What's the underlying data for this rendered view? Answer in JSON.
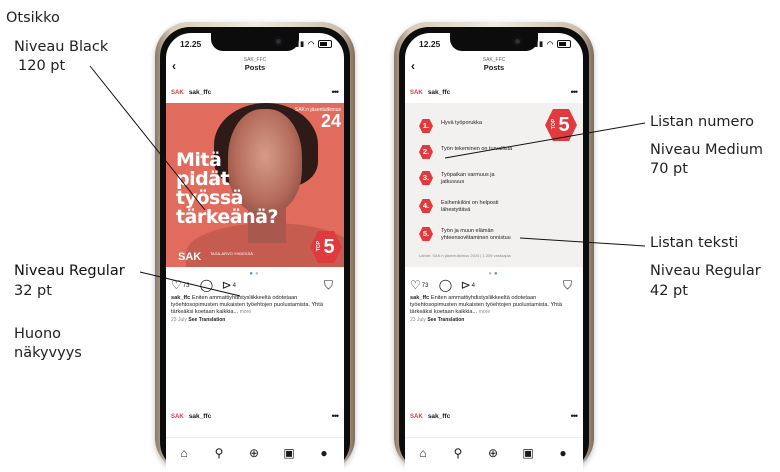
{
  "annotations": {
    "otsikko": "Otsikko",
    "otsikko_font": "Niveau Black",
    "otsikko_size": "120 pt",
    "caption_font": "Niveau Regular",
    "caption_size": "32 pt",
    "poor_visibility_1": "Huono",
    "poor_visibility_2": "näkyvyys",
    "list_number": "Listan numero",
    "list_number_font": "Niveau Medium",
    "list_number_size": "70 pt",
    "list_text": "Listan teksti",
    "list_text_font": "Niveau Regular",
    "list_text_size": "42 pt"
  },
  "phone": {
    "time": "12.25",
    "header_sub": "SAK_FFC",
    "header_title": "Posts",
    "logo": "SAK",
    "username": "sak_ffc",
    "likes": "73",
    "shares": "4",
    "caption_user": "sak_ffc",
    "caption_text": "Eniten ammattiyhdistysliikkeeltä odotetaan työehtosopimusten mukaisten työehtojen puolustamista. Yhtä tärkeäksi koetaan kaikkia...",
    "caption_more": "more",
    "date": "23 July",
    "see_translation": "See Translation"
  },
  "left_image": {
    "headline": [
      "Mitä",
      "pidät",
      "työssä",
      "tärkeänä?"
    ],
    "corner_label": "SAK:n jäsentutkimus",
    "corner_number": "24",
    "brand": "SAK",
    "brand_tagline": "TASA-ARVO YHDESSÄ",
    "badge_top": "TOP",
    "badge_num": "5"
  },
  "right_image": {
    "items": [
      {
        "num": "1.",
        "text": "Hyvä työporukka"
      },
      {
        "num": "2.",
        "text": "Työn tekeminen on turvallista"
      },
      {
        "num": "3.",
        "text": "Työpaikan varmuus ja jatkuvuus"
      },
      {
        "num": "4.",
        "text": "Esihenkilöni on helposti lähestyttävä"
      },
      {
        "num": "5.",
        "text": "Työn ja muun elämän yhteensovittaminen onnistuu"
      }
    ],
    "source": "Lähde: SAK:n jäsentutkimus 2024 | 1 209 vastaajaa",
    "badge_top": "TOP",
    "badge_num": "5"
  },
  "colors": {
    "accent": "#e03a3e",
    "photo_bg": "#e16c5d",
    "list_bg": "#f3f1ef"
  },
  "icons": [
    "back-icon",
    "more-icon",
    "heart-icon",
    "comment-icon",
    "share-icon",
    "bookmark-icon",
    "home-icon",
    "search-icon",
    "add-icon",
    "reels-icon",
    "profile-icon"
  ]
}
